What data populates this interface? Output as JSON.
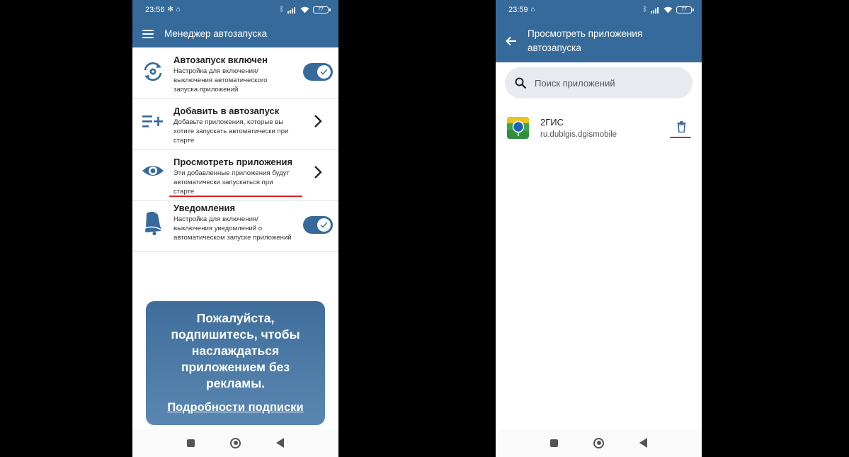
{
  "left": {
    "status": {
      "time": "23:56",
      "battery": "77"
    },
    "appbar": {
      "title": "Менеджер автозапуска"
    },
    "items": [
      {
        "title": "Автозапуск включен",
        "desc": "Настройка для включения/ выключения автоматического запуска приложений",
        "icon": "autostart-gear-refresh-icon",
        "control": "toggle-on"
      },
      {
        "title": "Добавить в автозапуск",
        "desc": "Добавьте приложения, которые вы хотите запускать автоматически при старте",
        "icon": "add-list-icon",
        "control": "chevron-right"
      },
      {
        "title": "Просмотреть приложения",
        "desc": "Эти добавленные приложения будут автоматически запускаться при старте",
        "icon": "eye-icon",
        "control": "chevron-right"
      },
      {
        "title": "Уведомления",
        "desc": "Настройка для включения/ выключения уведомлений о автоматическом запуске приложений",
        "icon": "bell-icon",
        "control": "toggle-on"
      }
    ],
    "promo": {
      "text": "Пожалуйста, подпишитесь, чтобы наслаждаться приложением без рекламы.",
      "link": "Подробности подписки"
    }
  },
  "right": {
    "status": {
      "time": "23:59",
      "battery": "77"
    },
    "appbar": {
      "title": "Просмотреть приложения автозапуска"
    },
    "search": {
      "placeholder": "Поиск приложений"
    },
    "apps": [
      {
        "name": "2ГИС",
        "package": "ru.dublgis.dgismobile"
      }
    ]
  },
  "colors": {
    "primary": "#366a9b",
    "annotation": "#d9202a"
  }
}
